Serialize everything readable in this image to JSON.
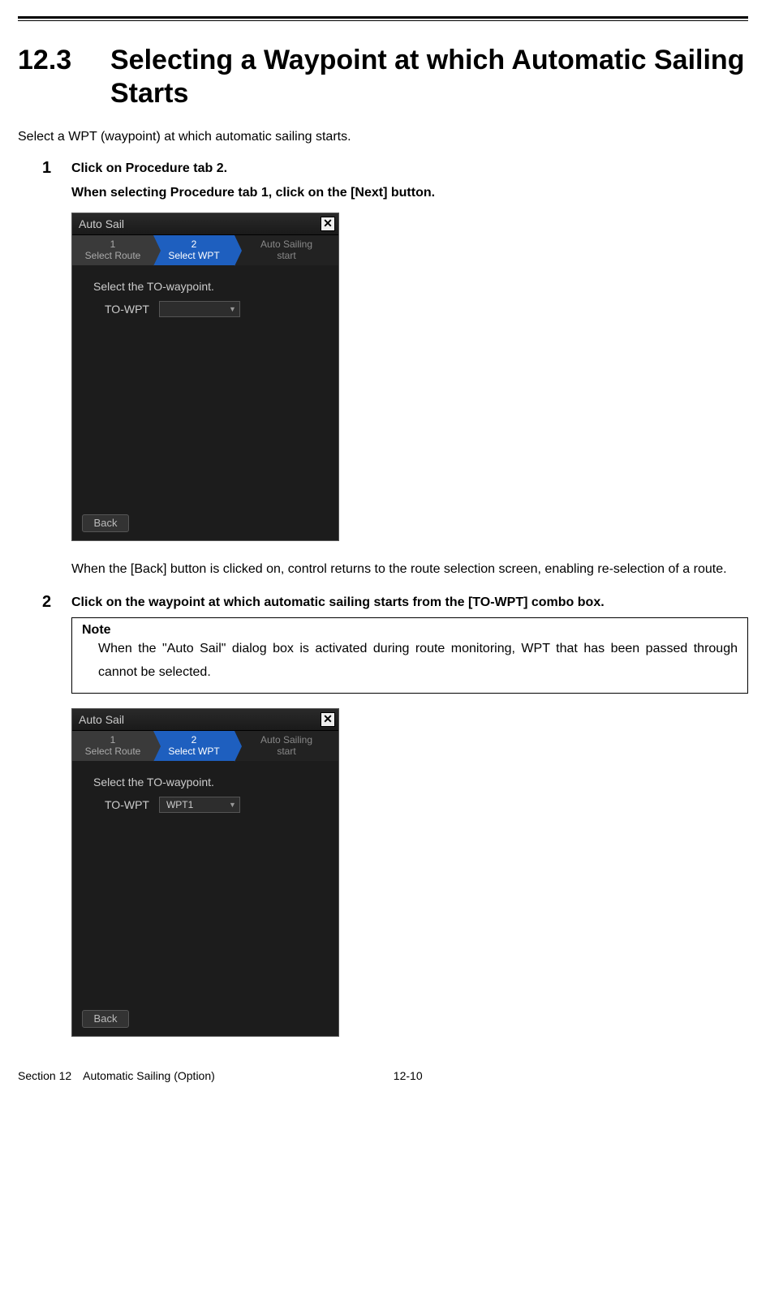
{
  "section": {
    "number": "12.3",
    "title": "Selecting a Waypoint at which Automatic Sailing Starts"
  },
  "intro": "Select a WPT (waypoint) at which automatic sailing starts.",
  "step1": {
    "num": "1",
    "line1": "Click on Procedure tab 2.",
    "line2": "When selecting Procedure tab 1, click on the [Next] button.",
    "after": "When the [Back] button is clicked on, control returns to the route selection screen, enabling re-selection of a route."
  },
  "step2": {
    "num": "2",
    "line1": "Click on the waypoint at which automatic sailing starts from the [TO-WPT] combo box."
  },
  "note": {
    "title": "Note",
    "body": "When the \"Auto Sail\" dialog box is activated during route monitoring, WPT that has been passed through cannot be selected."
  },
  "dialog": {
    "title": "Auto Sail",
    "tab1": {
      "n": "1",
      "label": "Select Route"
    },
    "tab2": {
      "n": "2",
      "label": "Select WPT"
    },
    "tab3a": "Auto Sailing",
    "tab3b": "start",
    "prompt": "Select the TO-waypoint.",
    "field_label": "TO-WPT",
    "combo_empty": "",
    "combo_value": "WPT1",
    "back": "Back",
    "close": "✕"
  },
  "footer": {
    "left": "Section 12 Automatic Sailing (Option)",
    "center": "12-10"
  }
}
